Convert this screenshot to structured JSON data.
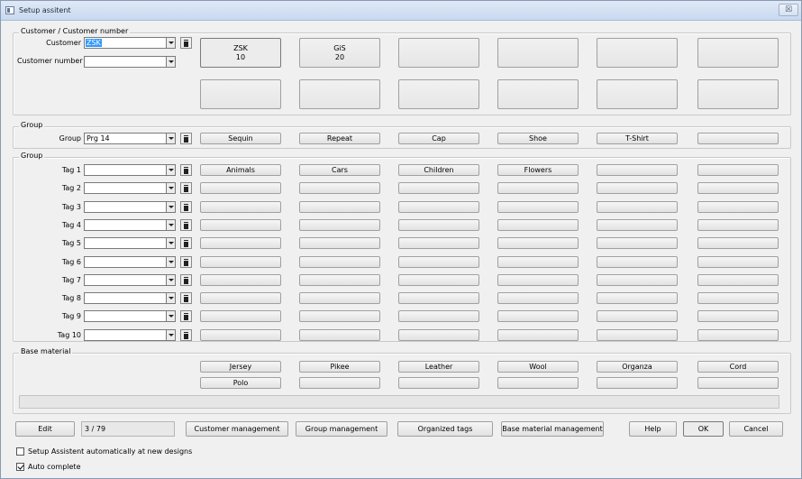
{
  "window": {
    "title": "Setup assitent",
    "close_glyph": "☒"
  },
  "customer_group": {
    "legend": "Customer / Customer number",
    "customer_label": "Customer",
    "customer_value": "ZSK",
    "customer_number_label": "Customer number",
    "customer_number_value": "",
    "buttons": [
      {
        "line1": "ZSK",
        "line2": "10"
      },
      {
        "line1": "GiS",
        "line2": "20"
      },
      {
        "line1": "",
        "line2": ""
      },
      {
        "line1": "",
        "line2": ""
      },
      {
        "line1": "",
        "line2": ""
      },
      {
        "line1": "",
        "line2": ""
      },
      {
        "line1": "",
        "line2": ""
      },
      {
        "line1": "",
        "line2": ""
      },
      {
        "line1": "",
        "line2": ""
      },
      {
        "line1": "",
        "line2": ""
      },
      {
        "line1": "",
        "line2": ""
      },
      {
        "line1": "",
        "line2": ""
      }
    ]
  },
  "group_section": {
    "legend": "Group",
    "group_label": "Group",
    "group_value": "Prg 14",
    "buttons": [
      "Sequin",
      "Repeat",
      "Cap",
      "Shoe",
      "T-Shirt",
      ""
    ]
  },
  "tags_section": {
    "legend": "Group",
    "rows": [
      {
        "label": "Tag 1",
        "value": "",
        "buttons": [
          "Animals",
          "Cars",
          "Children",
          "Flowers",
          "",
          ""
        ]
      },
      {
        "label": "Tag 2",
        "value": "",
        "buttons": [
          "",
          "",
          "",
          "",
          "",
          ""
        ]
      },
      {
        "label": "Tag 3",
        "value": "",
        "buttons": [
          "",
          "",
          "",
          "",
          "",
          ""
        ]
      },
      {
        "label": "Tag 4",
        "value": "",
        "buttons": [
          "",
          "",
          "",
          "",
          "",
          ""
        ]
      },
      {
        "label": "Tag 5",
        "value": "",
        "buttons": [
          "",
          "",
          "",
          "",
          "",
          ""
        ]
      },
      {
        "label": "Tag 6",
        "value": "",
        "buttons": [
          "",
          "",
          "",
          "",
          "",
          ""
        ]
      },
      {
        "label": "Tag 7",
        "value": "",
        "buttons": [
          "",
          "",
          "",
          "",
          "",
          ""
        ]
      },
      {
        "label": "Tag 8",
        "value": "",
        "buttons": [
          "",
          "",
          "",
          "",
          "",
          ""
        ]
      },
      {
        "label": "Tag 9",
        "value": "",
        "buttons": [
          "",
          "",
          "",
          "",
          "",
          ""
        ]
      },
      {
        "label": "Tag 10",
        "value": "",
        "buttons": [
          "",
          "",
          "",
          "",
          "",
          ""
        ]
      }
    ]
  },
  "base_material": {
    "legend": "Base material",
    "row1": [
      "Jersey",
      "Pikee",
      "Leather",
      "Wool",
      "Organza",
      "Cord"
    ],
    "row2": [
      "Polo",
      "",
      "",
      "",
      "",
      ""
    ]
  },
  "footer": {
    "edit_label": "Edit",
    "record_counter": "3 / 79",
    "customer_management": "Customer management",
    "group_management": "Group management",
    "organized_tags": "Organized tags",
    "base_material_management": "Base material management",
    "help": "Help",
    "ok": "OK",
    "cancel": "Cancel",
    "auto_setup_label": "Setup Assistent automatically at new designs",
    "auto_setup_checked": false,
    "auto_complete_label": "Auto complete",
    "auto_complete_checked": true
  },
  "icons": {
    "dropdown": "chevron-down-icon",
    "delete": "trash-icon",
    "app": "window-icon"
  }
}
